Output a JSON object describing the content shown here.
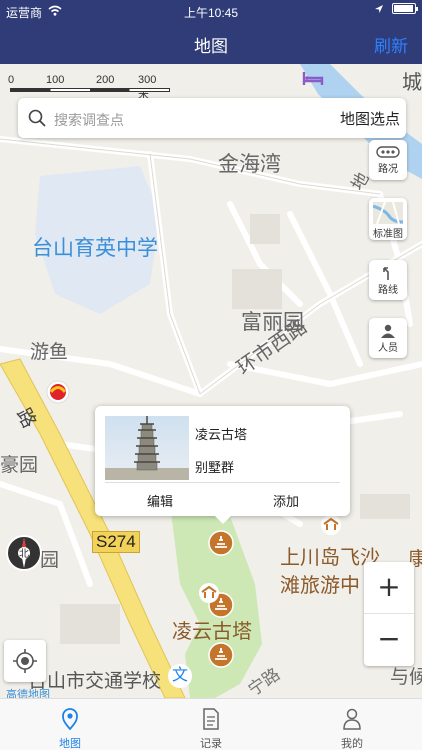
{
  "status": {
    "carrier": "运营商",
    "time": "上午10:45"
  },
  "nav": {
    "title": "地图",
    "refresh": "刷新"
  },
  "scale": {
    "t0": "0",
    "t1": "100",
    "t2": "200",
    "t3": "300 米"
  },
  "search": {
    "placeholder": "搜索调查点",
    "pick_label": "地图选点"
  },
  "side": {
    "traffic": "路况",
    "standard": "标准图",
    "route": "路线",
    "people": "人员"
  },
  "map_labels": {
    "cheng": "城",
    "jinhaiwan": "金海湾",
    "di": "地",
    "school": "台山育英中学",
    "fuliyuan": "富丽园",
    "youyu": "游鱼",
    "huanshi_xilu": "环市西路",
    "haoyuan": "豪园",
    "lu": "路",
    "yuan": "园",
    "s274": "S274",
    "shangchuan1": "上川岛飞沙",
    "shangchuan2": "滩旅游中",
    "lingyun": "凌云古塔",
    "jiaotong": "台山市交通学校",
    "ningning": "宁路",
    "kang": "康",
    "yu": "与候",
    "amap": "高德地图",
    "wen": "文"
  },
  "popup": {
    "name": "凌云古塔",
    "sub": "别墅群",
    "edit": "编辑",
    "add": "添加"
  },
  "zoom": {
    "plus": "+",
    "minus": "−"
  },
  "tabs": [
    {
      "label": "地图",
      "icon": "map-pin-icon"
    },
    {
      "label": "记录",
      "icon": "document-icon"
    },
    {
      "label": "我的",
      "icon": "user-icon"
    }
  ],
  "colors": {
    "nav": "#2f3c78",
    "accent": "#1c82e8",
    "river": "#aed2f0",
    "park": "#cde8b5",
    "road_yellow": "#f7e17a"
  }
}
